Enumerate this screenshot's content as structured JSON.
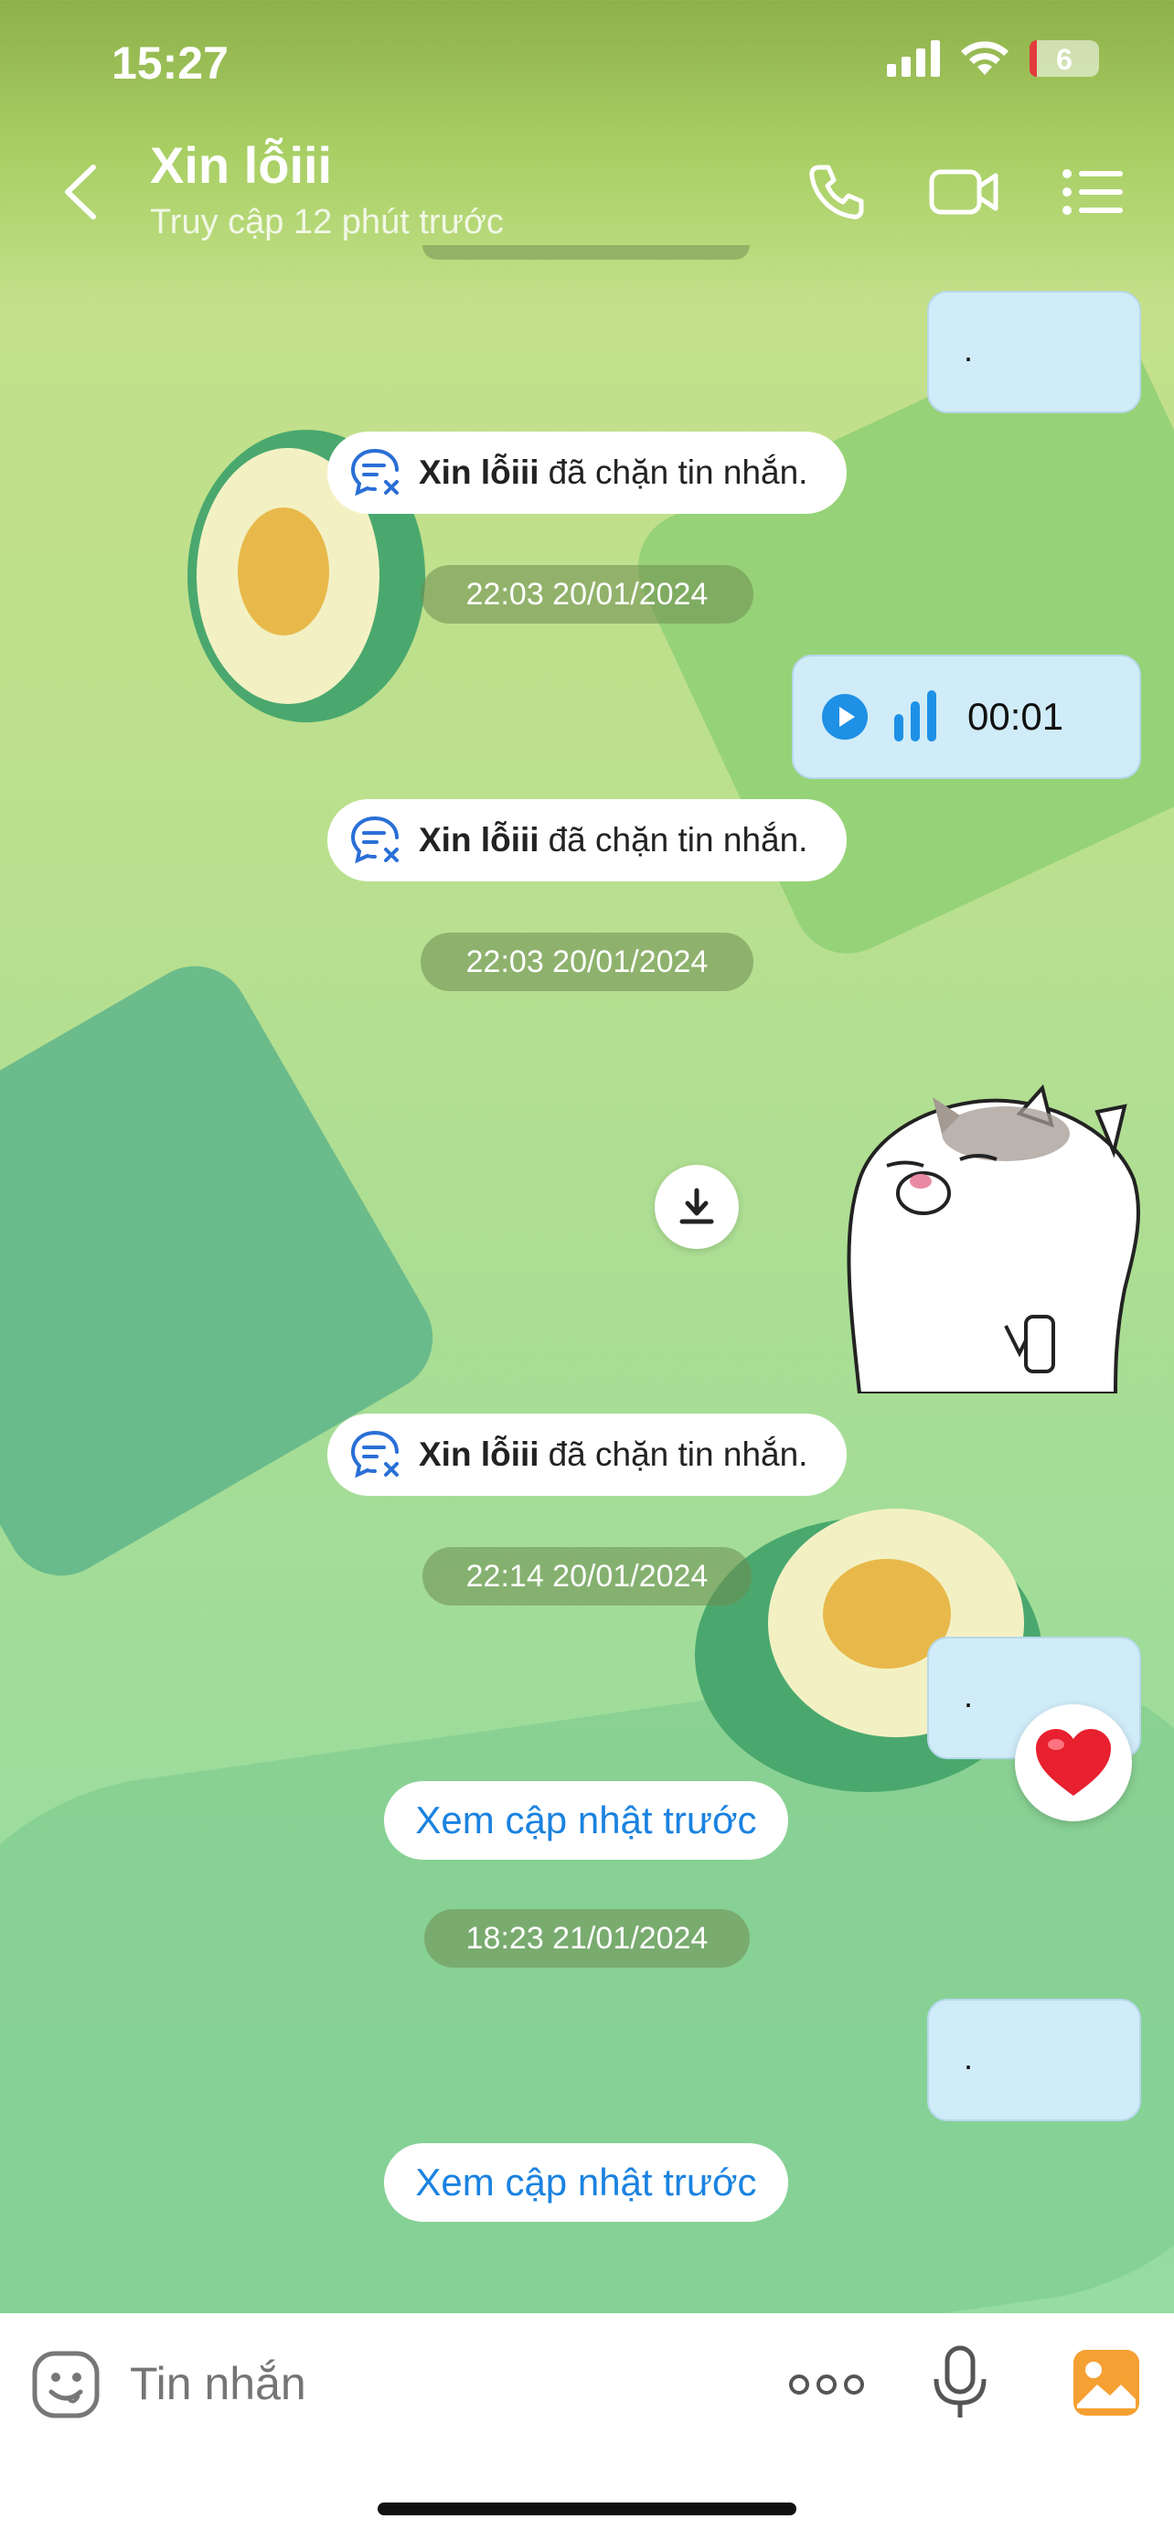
{
  "status_bar": {
    "time": "15:27",
    "battery": "6"
  },
  "header": {
    "title": "Xin lỗiii",
    "subtitle": "Truy cập 12 phút trước"
  },
  "messages": {
    "outgoing_1": ".",
    "notice_1": {
      "name": "Xin lỗiii",
      "text": "đã chặn tin nhắn."
    },
    "time_1": "22:03 20/01/2024",
    "voice": {
      "duration": "00:01"
    },
    "notice_2": {
      "name": "Xin lỗiii",
      "text": "đã chặn tin nhắn."
    },
    "time_2": "22:03 20/01/2024",
    "notice_3": {
      "name": "Xin lỗiii",
      "text": "đã chặn tin nhắn."
    },
    "time_3": "22:14 20/01/2024",
    "outgoing_2": ".",
    "update_link_1": "Xem cập nhật trước",
    "time_4": "18:23 21/01/2024",
    "outgoing_3": ".",
    "update_link_2": "Xem cập nhật trước"
  },
  "composer": {
    "placeholder": "Tin nhắn"
  },
  "colors": {
    "accent": "#1a82e0",
    "bubble_out": "#d0ecf8",
    "reaction": "#e8202f"
  }
}
